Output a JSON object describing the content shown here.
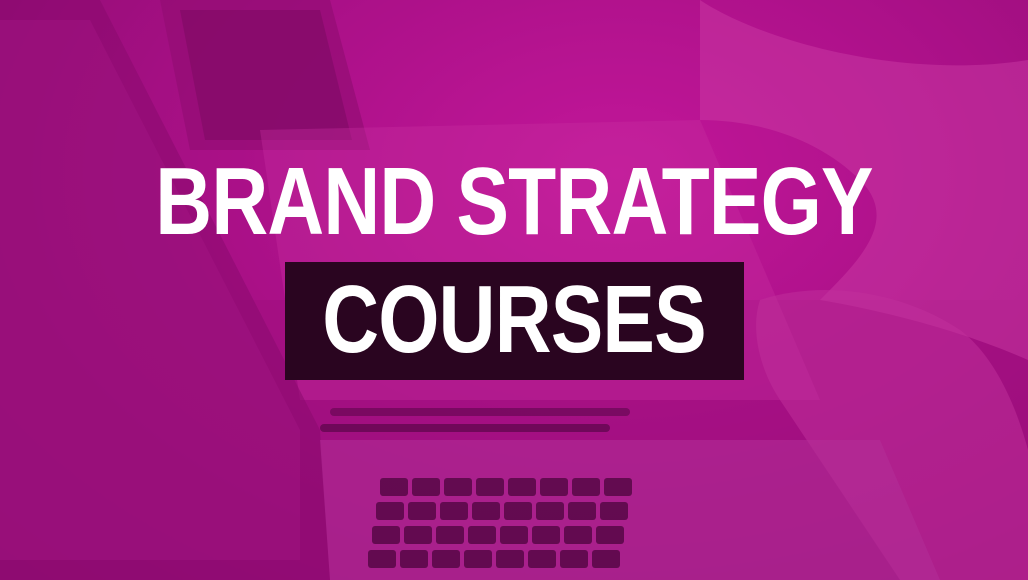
{
  "title": {
    "line1": "BRAND STRATEGY",
    "line2": "COURSES"
  },
  "colors": {
    "overlay_magenta": "#b0128c",
    "highlight_box": "#2a0520",
    "text": "#ffffff"
  }
}
